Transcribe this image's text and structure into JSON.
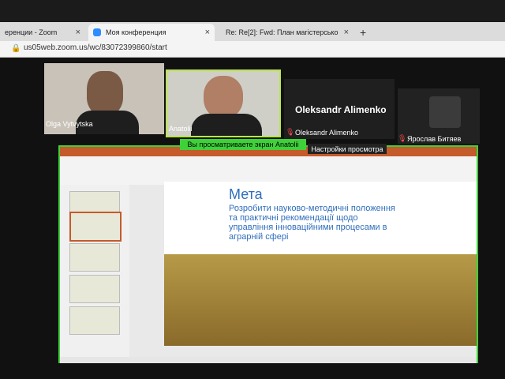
{
  "browser": {
    "tabs": [
      {
        "label": "еренции - Zoom"
      },
      {
        "label": "Моя конференция"
      },
      {
        "label": "Re: Re[2]: Fwd: План магістерсько"
      }
    ],
    "url": "us05web.zoom.us/wc/83072399860/start"
  },
  "participants": [
    {
      "name": "Olga Vytvytska"
    },
    {
      "name": "Anatolii"
    },
    {
      "name": "Oleksandr Alimenko",
      "label": "Oleksandr Alimenko"
    },
    {
      "name": "Ярослав Битяев"
    }
  ],
  "share": {
    "banner": "Вы просматриваете экран Anatolii",
    "settings": "Настройки просмотра"
  },
  "slide": {
    "title": "Мета",
    "body": "Розробити науково-методичні положення та практичні рекомендації щодо управління інноваційними процесами в аграрній сфері"
  },
  "colors": {
    "share_green": "#3fd13a",
    "ppt_orange": "#c55a2b",
    "title_blue": "#2f6ebc"
  }
}
